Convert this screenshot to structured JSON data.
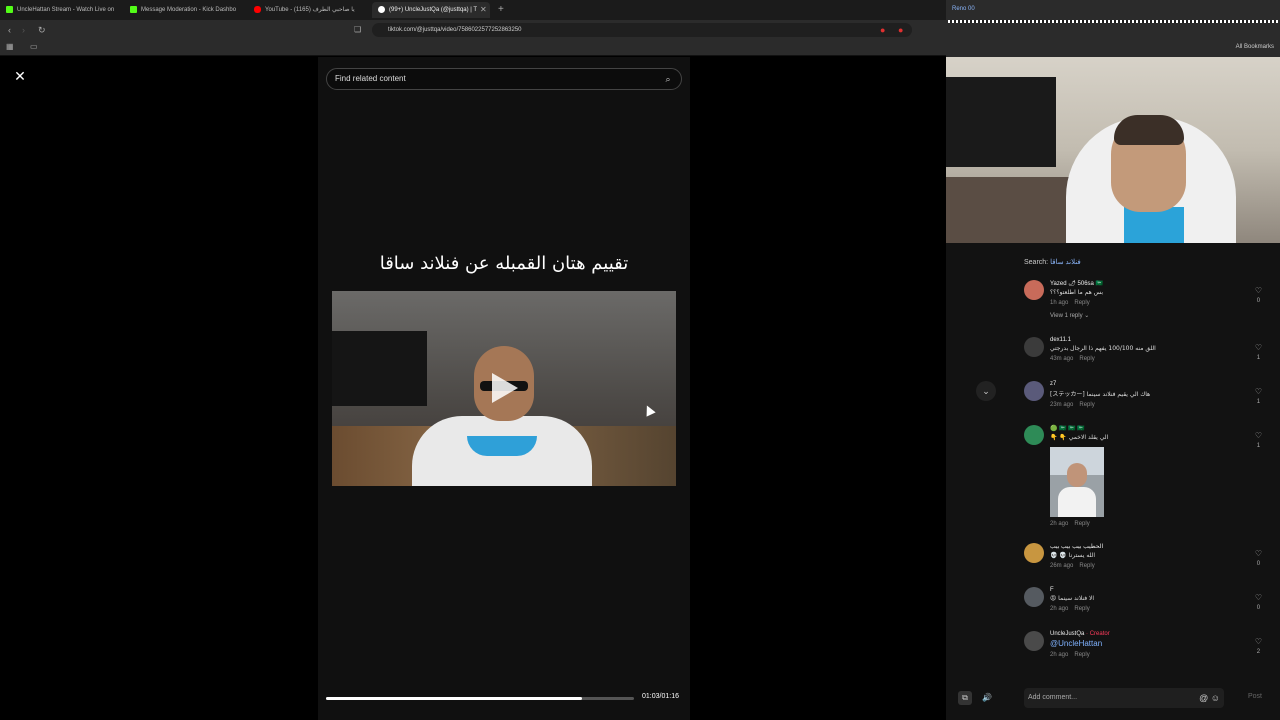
{
  "browser": {
    "tabs": [
      {
        "label": "UncleHattan Stream - Watch Live on",
        "color": "#53fc18"
      },
      {
        "label": "Message Moderation - Kick Dashbo",
        "color": "#53fc18"
      },
      {
        "label": "YouTube - يا صاحبي الطرف (1165)",
        "color": "#ff0000"
      },
      {
        "label": "(99+) UncleJustQa (@justtqa) | T",
        "color": "#ffffff"
      }
    ],
    "new_tab": "+",
    "url": "tiktok.com/@justtqa/video/7586022577252863250",
    "back": "‹",
    "forward": "›",
    "reload": "↻"
  },
  "webcam_overlay": {
    "top_label": "Reno 00",
    "all_bookmarks": "All Bookmarks"
  },
  "player": {
    "close": "✕",
    "search_placeholder": "Find related content",
    "video_title": "تقييم هتان القمبله عن فنلاند ساقا",
    "time": "01:03/01:16",
    "progress": 0.83
  },
  "comments": {
    "search_prefix": "Search:",
    "search_term": "فنلاند ساقا",
    "items": [
      {
        "user": "Yazed 🌶 506sa 🇸🇦",
        "text": "بس هم ما اطلعتو؟؟؟",
        "time": "1h ago",
        "reply": "Reply",
        "likes": "0",
        "avatar": "#c86b5a",
        "view_replies": "View 1 reply ⌄"
      },
      {
        "user": "dex11.1",
        "text": "اللق منه 100/100 يفهم ذا الرجال بدرجتي",
        "time": "43m ago",
        "reply": "Reply",
        "likes": "1",
        "avatar": "#3b3b3b"
      },
      {
        "user": "z7",
        "text": "[ステッカー] هاك الي يقيم فنلاند سينما",
        "time": "23m ago",
        "reply": "Reply",
        "likes": "1",
        "avatar": "#5a5a7a"
      },
      {
        "user": "🟢 🇸🇦 🇸🇦 🇸🇦",
        "text": "👇 👇 الي يقلد الاخمي",
        "time": "2h ago",
        "reply": "Reply",
        "likes": "1",
        "avatar": "#2e8b57"
      },
      {
        "user": "الحطيب بيب بيب بيب",
        "text": "💀 💀 الله يسترنا",
        "time": "26m ago",
        "reply": "Reply",
        "likes": "0",
        "avatar": "#c89640"
      },
      {
        "user": "F",
        "text": "😡 الا فنلاند سينما",
        "time": "2h ago",
        "reply": "Reply",
        "likes": "0",
        "avatar": "#555a60"
      },
      {
        "user": "UncleJustQa",
        "creator": "· Creator",
        "mention": "@UncleHattan",
        "time": "2h ago",
        "reply": "Reply",
        "likes": "2",
        "avatar": "#4a4a4a"
      }
    ],
    "add_comment_placeholder": "Add comment...",
    "post": "Post"
  }
}
